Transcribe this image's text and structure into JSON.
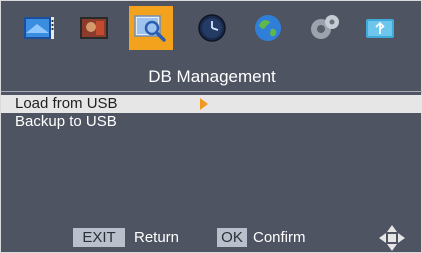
{
  "icons": [
    {
      "name": "tv-icon",
      "active": false
    },
    {
      "name": "picture-icon",
      "active": false
    },
    {
      "name": "search-icon",
      "active": true
    },
    {
      "name": "clock-icon",
      "active": false
    },
    {
      "name": "globe-icon",
      "active": false
    },
    {
      "name": "settings-icon",
      "active": false
    },
    {
      "name": "usb-icon",
      "active": false
    }
  ],
  "title": "DB Management",
  "menu": {
    "items": [
      {
        "label": "Load from USB",
        "selected": true
      },
      {
        "label": "Backup to USB",
        "selected": false
      }
    ]
  },
  "footer": {
    "exit_key": "EXIT",
    "exit_label": "Return",
    "ok_key": "OK",
    "ok_label": "Confirm",
    "nav_icon": "dpad-icon"
  },
  "colors": {
    "background": "#4f5463",
    "active_tab": "#f2a21c",
    "selection": "#e6e6e6",
    "arrow": "#f39a1e",
    "key_bg": "#b9bfcb"
  }
}
